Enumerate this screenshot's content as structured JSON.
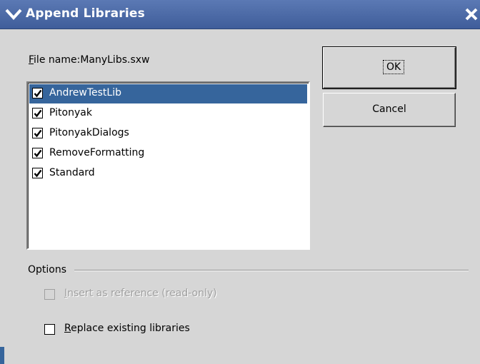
{
  "window": {
    "title": "Append Libraries",
    "menu_icon": "chevron-down-icon",
    "close_icon": "close-icon"
  },
  "file": {
    "label_prefix": "F",
    "label_rest": "ile name:",
    "value": "ManyLibs.sxw"
  },
  "libraries": [
    {
      "label": "AndrewTestLib",
      "checked": true,
      "selected": true
    },
    {
      "label": "Pitonyak",
      "checked": true,
      "selected": false
    },
    {
      "label": "PitonyakDialogs",
      "checked": true,
      "selected": false
    },
    {
      "label": "RemoveFormatting",
      "checked": true,
      "selected": false
    },
    {
      "label": "Standard",
      "checked": true,
      "selected": false
    }
  ],
  "buttons": {
    "ok": "OK",
    "cancel": "Cancel"
  },
  "options": {
    "title": "Options",
    "insert_reference": {
      "mnemonic": "I",
      "rest": "nsert as reference (read-only)",
      "checked": false,
      "enabled": false
    },
    "replace_existing": {
      "mnemonic": "R",
      "rest": "eplace existing libraries",
      "checked": false,
      "enabled": true
    }
  },
  "colors": {
    "titlebar": "#4a69a8",
    "selection": "#36659c",
    "dialog_bg": "#d6d6d6"
  }
}
